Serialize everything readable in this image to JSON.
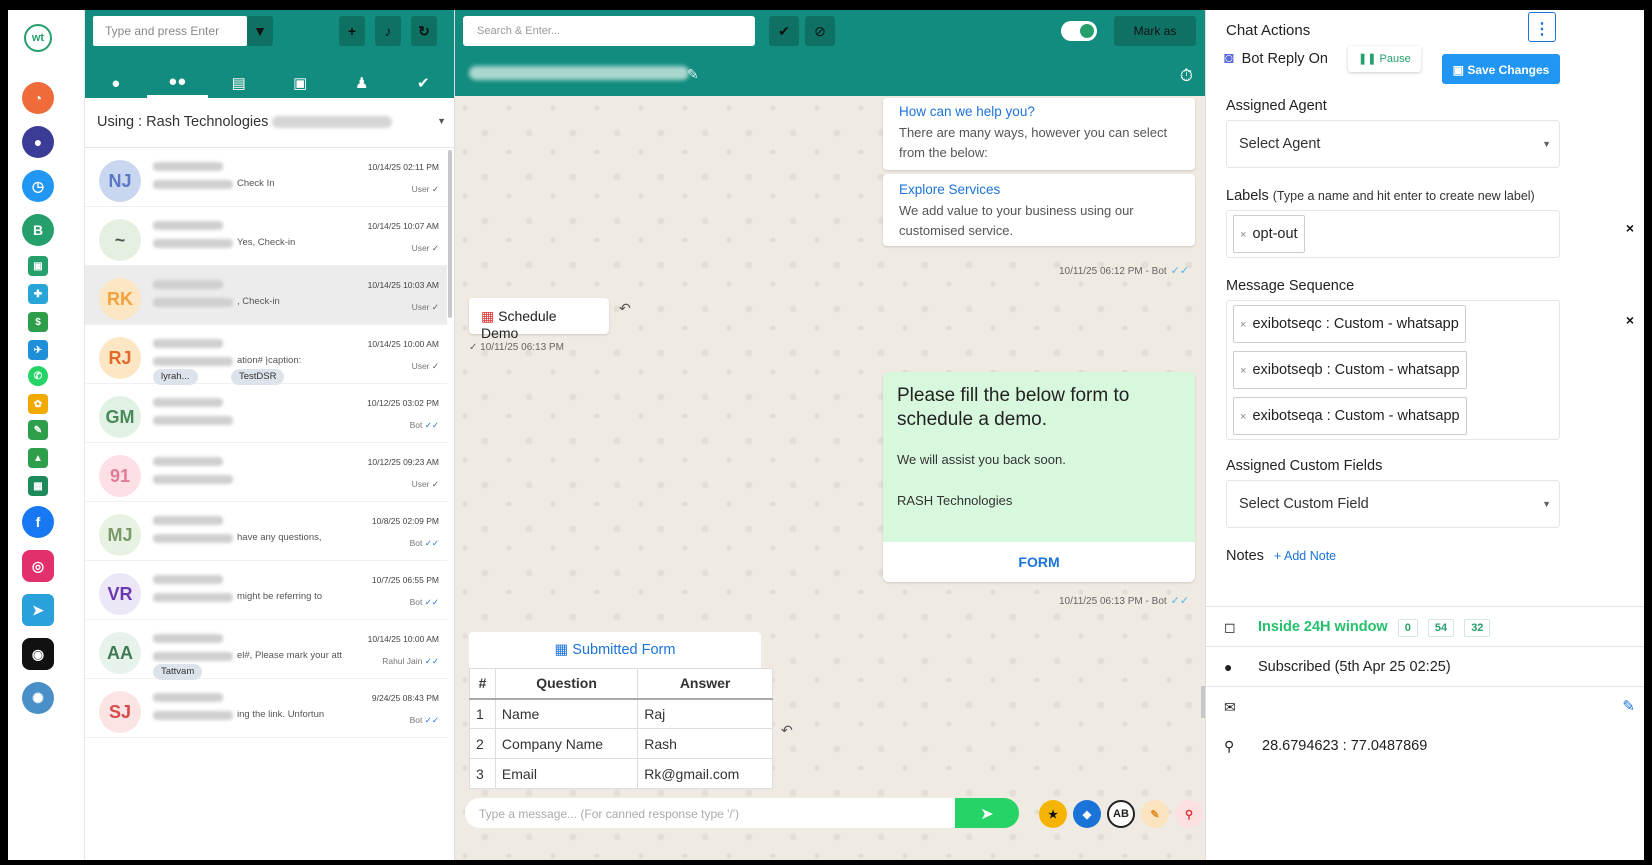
{
  "brand": {
    "logo_text": "wt"
  },
  "rail": {
    "icons": [
      {
        "name": "dashboard-icon",
        "color": "#ef6c3a"
      },
      {
        "name": "chat-icon",
        "color": "#3b3b98"
      },
      {
        "name": "analytics-icon",
        "color": "#2196f3"
      },
      {
        "name": "whatsapp-business-icon",
        "color": "#25a06c"
      },
      {
        "name": "facebook-icon",
        "color": "#1877f2"
      },
      {
        "name": "instagram-icon",
        "color": "#e1306c"
      },
      {
        "name": "telegram-icon",
        "color": "#2aa1da"
      },
      {
        "name": "messenger-icon",
        "color": "#111111"
      },
      {
        "name": "settings-icon",
        "color": "#4a90c8"
      }
    ]
  },
  "list": {
    "search_placeholder": "Type and press Enter",
    "using_label": "Using : Rash Technologies",
    "rows": [
      {
        "initials": "NJ",
        "snippet": "Check In",
        "time": "10/14/25 02:11 PM",
        "who": "User",
        "ticks": "✓",
        "color": "#c9d6f0",
        "text": "#5a78c4"
      },
      {
        "initials": "~",
        "snippet": "Yes, Check-in",
        "time": "10/14/25 10:07 AM",
        "who": "User",
        "ticks": "✓",
        "color": "#e6f0e1",
        "text": "#555"
      },
      {
        "initials": "RK",
        "snippet": ", Check-in",
        "time": "10/14/25 10:03 AM",
        "who": "User",
        "ticks": "✓",
        "color": "#fce6c4",
        "text": "#f3a13b"
      },
      {
        "initials": "RJ",
        "snippet": "ation# |caption:",
        "time": "10/14/25 10:00 AM",
        "who": "User",
        "ticks": "✓",
        "color": "#fce6c4",
        "text": "#e06b2b",
        "chips": [
          "lyrah...",
          "TestDSR"
        ]
      },
      {
        "initials": "GM",
        "snippet": "",
        "time": "10/12/25 03:02 PM",
        "who": "Bot",
        "ticks": "✓✓",
        "color": "#e1f2e4",
        "text": "#4a8a5a"
      },
      {
        "initials": "91",
        "snippet": "",
        "time": "10/12/25 09:23 AM",
        "who": "User",
        "ticks": "✓",
        "color": "#fde0e6",
        "text": "#e27a95"
      },
      {
        "initials": "MJ",
        "snippet": "have any questions,",
        "time": "10/8/25 02:09 PM",
        "who": "Bot",
        "ticks": "✓✓",
        "color": "#e8f2e2",
        "text": "#7a9a6a"
      },
      {
        "initials": "VR",
        "snippet": "might be referring to",
        "time": "10/7/25 06:55 PM",
        "who": "Bot",
        "ticks": "✓✓",
        "color": "#ece6f7",
        "text": "#6a3ab0"
      },
      {
        "initials": "AA",
        "snippet": "el#, Please mark your att",
        "time": "10/14/25 10:00 AM",
        "who": "Rahul Jain",
        "ticks": "✓✓",
        "color": "#e6f2ea",
        "text": "#3f7a55",
        "chips": [
          "Tattvam"
        ]
      },
      {
        "initials": "SJ",
        "snippet": "ing the link. Unfortun",
        "time": "9/24/25 08:43 PM",
        "who": "Bot",
        "ticks": "✓✓",
        "color": "#fde4e4",
        "text": "#d84a4a"
      }
    ]
  },
  "chat": {
    "search_placeholder": "Search & Enter...",
    "mark_as": "Mark as",
    "help_title": "How can we help you?",
    "help_text": "There are many ways, however you can select from the below:",
    "explore_title": "Explore Services",
    "explore_text": "We add value to your business using our customised service.",
    "bot_meta_1": "10/11/25 06:12 PM - Bot",
    "schedule_demo": "Schedule Demo",
    "schedule_time": "10/11/25 06:13 PM",
    "form_title": "Please fill the below form to schedule a demo.",
    "form_sub": "We will assist you back soon.",
    "form_org": "RASH Technologies",
    "form_button": "FORM",
    "bot_meta_2": "10/11/25 06:13 PM - Bot",
    "submitted_title": "Submitted Form",
    "table_headers": [
      "#",
      "Question",
      "Answer"
    ],
    "table_rows": [
      [
        "1",
        "Name",
        "Raj"
      ],
      [
        "2",
        "Company Name",
        "Rash"
      ],
      [
        "3",
        "Email",
        "Rk@gmail.com"
      ]
    ],
    "composer_placeholder": "Type a message... (For canned response type '/')"
  },
  "panel": {
    "title": "Chat Actions",
    "bot_reply": "Bot Reply On",
    "pause": "Pause",
    "save": "Save Changes",
    "assigned_agent_label": "Assigned Agent",
    "select_agent": "Select Agent",
    "labels_label": "Labels",
    "labels_hint": "(Type a name and hit enter to create new label)",
    "labels": [
      "opt-out"
    ],
    "sequence_label": "Message Sequence",
    "sequences": [
      "exibotseqc : Custom - whatsapp",
      "exibotseqb : Custom - whatsapp",
      "exibotseqa : Custom - whatsapp"
    ],
    "custom_fields_label": "Assigned Custom Fields",
    "select_custom_field": "Select Custom Field",
    "notes_label": "Notes",
    "add_note": "Add Note",
    "window_text": "Inside 24H window",
    "window_counts": [
      "0",
      "54",
      "32"
    ],
    "subscribed": "Subscribed (5th Apr 25 02:25)",
    "coords": "28.6794623 : 77.0487869"
  }
}
